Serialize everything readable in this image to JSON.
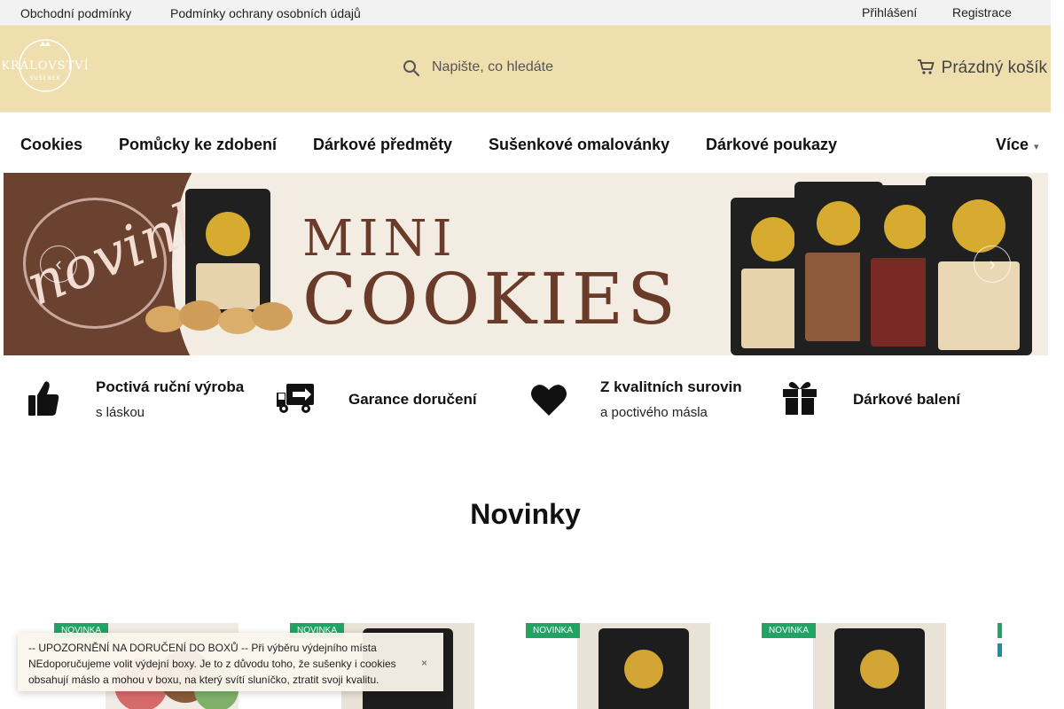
{
  "topbar": {
    "links_left": [
      "Obchodní podmínky",
      "Podmínky ochrany osobních údajů"
    ],
    "login": "Přihlášení",
    "register": "Registrace"
  },
  "header": {
    "search_placeholder": "Napište, co hledáte",
    "cart_label": "Prázdný košík",
    "logo_text": "KRÁLOVSTVÍ SUŠENEK"
  },
  "nav": {
    "items": [
      "Cookies",
      "Pomůcky ke zdobení",
      "Dárkové předměty",
      "Sušenkové omalovánky",
      "Dárkové poukazy"
    ],
    "more": "Více"
  },
  "banner": {
    "tag": "novinka",
    "title_top": "MINI",
    "title_bottom": "COOKIES"
  },
  "benefits": [
    {
      "title": "Poctivá ruční výroba",
      "subtitle": "s láskou",
      "icon": "thumbs-up-icon"
    },
    {
      "title": "Garance doručení",
      "subtitle": "",
      "icon": "delivery-truck-icon"
    },
    {
      "title": "Z kvalitních surovin",
      "subtitle": "a poctivého másla",
      "icon": "heart-icon"
    },
    {
      "title": "Dárkové balení",
      "subtitle": "",
      "icon": "gift-icon"
    }
  ],
  "section_title": "Novinky",
  "products": [
    {
      "badge": "NOVINKA"
    },
    {
      "badge": "NOVINKA"
    },
    {
      "badge": "NOVINKA"
    },
    {
      "badge": "NOVINKA"
    }
  ],
  "notice": {
    "text": "-- UPOZORNĚNÍ NA DORUČENÍ DO BOXŮ -- Při výběru výdejního místa NEdoporučujeme volit výdejní boxy. Je to z důvodu toho, že sušenky i cookies obsahují máslo a mohou v boxu, na který svítí sluníčko, ztratit svoji kvalitu.",
    "close_label": "×"
  },
  "colors": {
    "header_bg": "#efdfae",
    "badge_green": "#21a364",
    "banner_brown": "#6b3b2a"
  }
}
